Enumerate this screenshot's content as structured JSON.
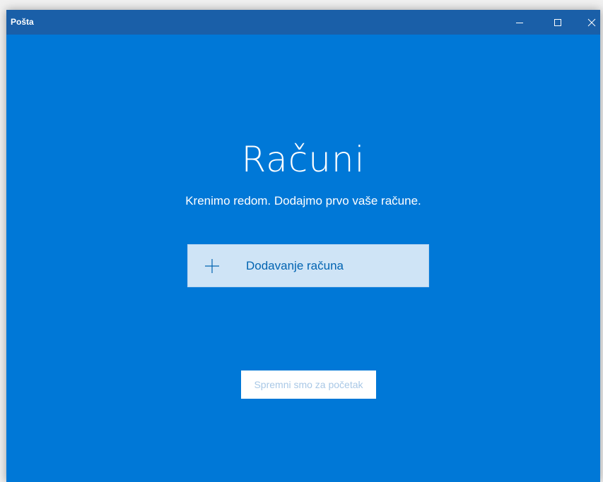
{
  "window": {
    "title": "Pošta",
    "controls": {
      "minimize_icon": "minimize-icon",
      "maximize_icon": "maximize-icon",
      "close_icon": "close-icon"
    }
  },
  "main": {
    "heading": "Računi",
    "subtitle": "Krenimo redom. Dodajmo prvo vaše račune.",
    "add_account": {
      "label": "Dodavanje računa",
      "icon": "plus-icon"
    },
    "ready_button": {
      "label": "Spremni smo za početak",
      "state": "disabled"
    }
  },
  "colors": {
    "background": "#0078d7",
    "titlebar": "#1a5fa8",
    "add_account_bg": "#cfe4f6",
    "add_account_text": "#0063b1",
    "ready_button_bg": "#ffffff",
    "ready_button_text": "#a9c8e6"
  }
}
